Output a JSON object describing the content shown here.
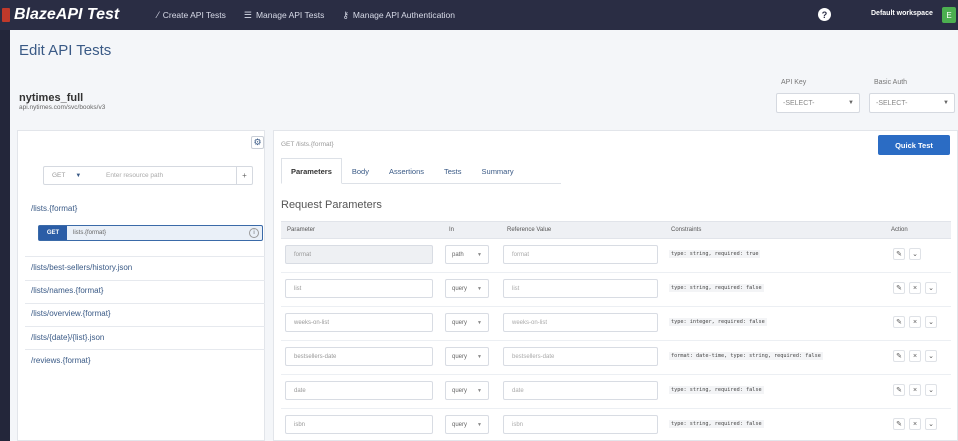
{
  "brand": {
    "name": "BlazeAPI Test"
  },
  "nav": {
    "links": [
      {
        "icon": "wand-icon",
        "label": "Create API Tests"
      },
      {
        "icon": "list-icon",
        "label": "Manage API Tests"
      },
      {
        "icon": "key-icon",
        "label": "Manage API Authentication"
      }
    ],
    "help": "?",
    "workspace": "Default workspace",
    "workspace_badge": "E"
  },
  "page": {
    "title": "Edit API Tests",
    "api_name": "nytimes_full",
    "api_url": "api.nytimes.com/svc/books/v3"
  },
  "auth": {
    "api_key_label": "API Key",
    "api_key_value": "-SELECT-",
    "basic_auth_label": "Basic Auth",
    "basic_auth_value": "-SELECT-"
  },
  "resources": {
    "new_method": "GET",
    "new_path_placeholder": "Enter resource path",
    "add_symbol": "+",
    "group_label": "/lists.{format}",
    "active": {
      "method": "GET",
      "path": "lists.{format}"
    },
    "items": [
      "/lists/best-sellers/history.json",
      "/lists/names.{format}",
      "/lists/overview.{format}",
      "/lists/{date}/{list}.json",
      "/reviews.{format}"
    ]
  },
  "editor": {
    "endpoint": "GET /lists.{format}",
    "quick_test": "Quick Test",
    "tabs": [
      "Parameters",
      "Body",
      "Assertions",
      "Tests",
      "Summary"
    ],
    "active_tab": "Parameters",
    "section_title": "Request Parameters",
    "columns": [
      "Parameter",
      "In",
      "Reference Value",
      "Constraints",
      "Action"
    ],
    "rows": [
      {
        "param": "format",
        "in": "path",
        "ref": "format",
        "constraint": "type: string, required: true"
      },
      {
        "param": "list",
        "in": "query",
        "ref": "list",
        "constraint": "type: string, required: false"
      },
      {
        "param": "weeks-on-list",
        "in": "query",
        "ref": "weeks-on-list",
        "constraint": "type: integer, required: false"
      },
      {
        "param": "bestsellers-date",
        "in": "query",
        "ref": "bestsellers-date",
        "constraint": "format: date-time, type: string, required: false"
      },
      {
        "param": "date",
        "in": "query",
        "ref": "date",
        "constraint": "type: string, required: false"
      },
      {
        "param": "isbn",
        "in": "query",
        "ref": "isbn",
        "constraint": "type: string, required: false"
      }
    ]
  },
  "colors": {
    "navbar": "#2a2d44",
    "accent": "#2b6cc4",
    "link": "#3a5a86",
    "brand_mark": "#c0392b"
  }
}
